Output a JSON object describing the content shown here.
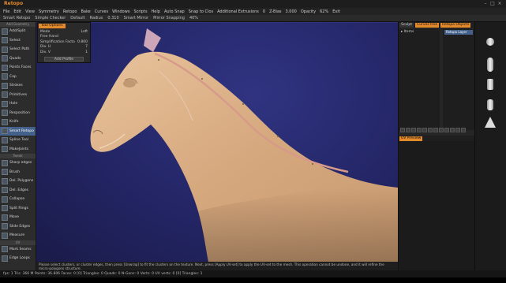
{
  "app": {
    "title": "Retopo"
  },
  "menubar": [
    "File",
    "Edit",
    "View",
    "Symmetry",
    "Retopo",
    "Bake",
    "Curves",
    "Windows",
    "Scripts",
    "Help",
    "Auto Snap",
    "Snap to Clos",
    "Additional Extrusions",
    "0",
    "Z-Bias",
    "3.000",
    "Opacity",
    "62%",
    "Exit"
  ],
  "toolbar": [
    "Smart Retopo",
    "Simple Checker",
    "Default",
    "Radius",
    "0.310",
    "Smart Mirror",
    "Mirror Snapping",
    "40%"
  ],
  "left_panel": {
    "section_top": "Add Geometry",
    "tools_top": [
      {
        "label": "Add/Split",
        "active": false
      },
      {
        "label": "Select",
        "active": false
      },
      {
        "label": "Select Path",
        "active": false
      },
      {
        "label": "Quads",
        "active": false
      },
      {
        "label": "Points Faces",
        "active": false
      },
      {
        "label": "Cap",
        "active": false
      },
      {
        "label": "Strokes",
        "active": false
      },
      {
        "label": "Primitives",
        "active": false
      },
      {
        "label": "Hole",
        "active": false
      },
      {
        "label": "Resposition",
        "active": false
      },
      {
        "label": "Knife",
        "active": false
      },
      {
        "label": "Smart Retopo",
        "active": true
      },
      {
        "label": "Spline Tool",
        "active": false
      },
      {
        "label": "MakeJoints",
        "active": false
      }
    ],
    "section_tweak": "Tweak",
    "tools_tweak": [
      {
        "label": "Sharp edges"
      },
      {
        "label": "Brush"
      },
      {
        "label": "Del. Polygons"
      },
      {
        "label": "Del. Edges"
      },
      {
        "label": "Collapse"
      },
      {
        "label": "Split Rings"
      },
      {
        "label": "Move"
      },
      {
        "label": "Slide Edges"
      },
      {
        "label": "Measure"
      }
    ],
    "section_uv": "UV",
    "tools_uv": [
      {
        "label": "Mark Seams"
      },
      {
        "label": "Edge Loops"
      }
    ]
  },
  "tool_options": {
    "tab": "Tool Options",
    "rows": [
      {
        "label": "Mode",
        "value": "Loft"
      },
      {
        "label": "Free Hand",
        "value": ""
      },
      {
        "label": "Simplification Facto",
        "value": "0.800"
      },
      {
        "label": "Div. U",
        "value": "7"
      },
      {
        "label": "Div. V",
        "value": "1"
      }
    ],
    "button": "Add Profile"
  },
  "right_panel": {
    "tabs": [
      {
        "label": "Sculpt",
        "on": false
      },
      {
        "label": "Curves tree",
        "on": true
      },
      {
        "label": "Retopo Objects",
        "on": true
      }
    ],
    "tree_item": "Items",
    "retopo_item": "Retopo Layer",
    "uv_tab": "UV Preview"
  },
  "hint": "Please select clusters, or cluster edges, then press [Unwrap] to fit the clusters on the texture. Next, press [Apply UV-set] to apply the UV-set to the mesh. This operation cannot be undone, and it will refine the micro-polygons structure.",
  "status": "fps: 1 Tris: 366 M Points: 36.806 Faces: 0 [0] Triangles: 0 Quads: 0 N-Gons: 0 Verts: 0 UV verts: 0 [0] Triangles: 1",
  "colors": {
    "accent": "#e38a2c",
    "viewport": "#2a2d6f",
    "active_tool": "#43618a",
    "horse": "#d9b08c"
  }
}
